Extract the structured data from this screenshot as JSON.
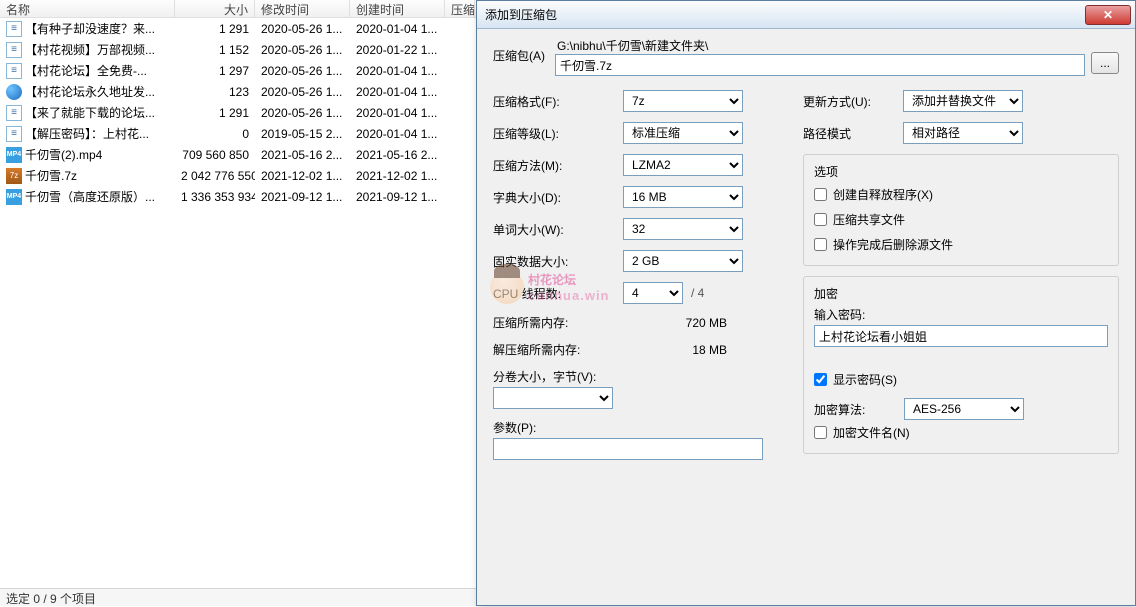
{
  "file_header": {
    "name": "名称",
    "size": "大小",
    "mod": "修改时间",
    "create": "创建时间",
    "comp": "压缩"
  },
  "files": [
    {
      "icon": "txt",
      "name": "【有种子却没速度？来...",
      "size": "1 291",
      "mod": "2020-05-26 1...",
      "create": "2020-01-04 1..."
    },
    {
      "icon": "txt",
      "name": "【村花视频】万部视频...",
      "size": "1 152",
      "mod": "2020-05-26 1...",
      "create": "2020-01-22 1..."
    },
    {
      "icon": "txt",
      "name": "【村花论坛】全免费-...",
      "size": "1 297",
      "mod": "2020-05-26 1...",
      "create": "2020-01-04 1..."
    },
    {
      "icon": "globe",
      "name": "【村花论坛永久地址发...",
      "size": "123",
      "mod": "2020-05-26 1...",
      "create": "2020-01-04 1..."
    },
    {
      "icon": "txt",
      "name": "【来了就能下载的论坛...",
      "size": "1 291",
      "mod": "2020-05-26 1...",
      "create": "2020-01-04 1..."
    },
    {
      "icon": "txt",
      "name": "【解压密码】：上村花...",
      "size": "0",
      "mod": "2019-05-15 2...",
      "create": "2020-01-04 1..."
    },
    {
      "icon": "mp4",
      "name": "千仞雪(2).mp4",
      "size": "709 560 850",
      "mod": "2021-05-16 2...",
      "create": "2021-05-16 2..."
    },
    {
      "icon": "7z",
      "name": "千仞雪.7z",
      "size": "2 042 776 550",
      "mod": "2021-12-02 1...",
      "create": "2021-12-02 1..."
    },
    {
      "icon": "mp4",
      "name": "千仞雪（高度还原版）...",
      "size": "1 336 353 934",
      "mod": "2021-09-12 1...",
      "create": "2021-09-12 1..."
    }
  ],
  "status": "选定 0 / 9 个项目",
  "dialog": {
    "title": "添加到压缩包",
    "archive_label": "压缩包(A)",
    "path": "G:\\nibhu\\千仞雪\\新建文件夹\\",
    "filename": "千仞雪.7z",
    "browse": "...",
    "format_label": "压缩格式(F):",
    "format_value": "7z",
    "level_label": "压缩等级(L):",
    "level_value": "标准压缩",
    "method_label": "压缩方法(M):",
    "method_value": "LZMA2",
    "dict_label": "字典大小(D):",
    "dict_value": "16 MB",
    "word_label": "单词大小(W):",
    "word_value": "32",
    "block_label": "固实数据大小:",
    "block_value": "2 GB",
    "threads_label": "CPU 线程数:",
    "threads_value": "4",
    "threads_max": "/ 4",
    "mem_comp_label": "压缩所需内存:",
    "mem_comp_value": "720 MB",
    "mem_decomp_label": "解压缩所需内存:",
    "mem_decomp_value": "18 MB",
    "volume_label": "分卷大小，字节(V):",
    "params_label": "参数(P):",
    "update_label": "更新方式(U):",
    "update_value": "添加并替换文件",
    "pathmode_label": "路径模式",
    "pathmode_value": "相对路径",
    "options_label": "选项",
    "opt_sfx": "创建自释放程序(X)",
    "opt_shared": "压缩共享文件",
    "opt_delete": "操作完成后删除源文件",
    "enc_label": "加密",
    "pw_label": "输入密码:",
    "pw_value": "上村花论坛看小姐姐",
    "show_pw": "显示密码(S)",
    "enc_method_label": "加密算法:",
    "enc_method_value": "AES-256",
    "enc_names": "加密文件名(N)"
  },
  "watermark": {
    "text": "村花论坛",
    "sub": "cunhua.win"
  }
}
